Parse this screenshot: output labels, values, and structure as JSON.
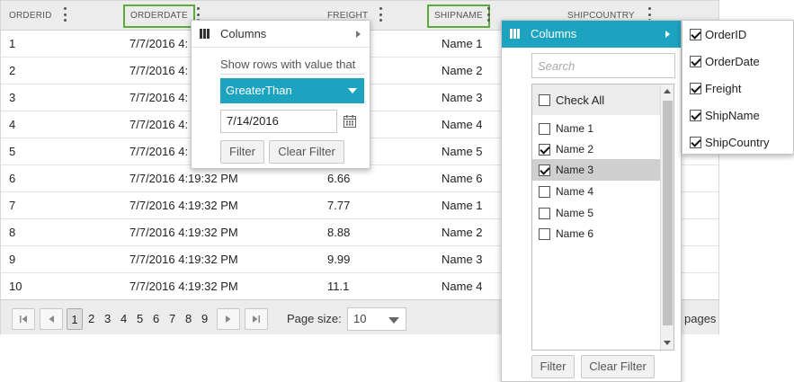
{
  "grid": {
    "columns": [
      {
        "id": "orderid",
        "label": "ORDERID"
      },
      {
        "id": "orderdate",
        "label": "ORDERDATE"
      },
      {
        "id": "freight",
        "label": "FREIGHT"
      },
      {
        "id": "shipname",
        "label": "SHIPNAME"
      },
      {
        "id": "shipcountry",
        "label": "SHIPCOUNTRY"
      }
    ],
    "rows": [
      {
        "orderid": "1",
        "orderdate": "7/7/2016 4:",
        "shipname": "Name 1"
      },
      {
        "orderid": "2",
        "orderdate": "7/7/2016 4:",
        "shipname": "Name 2"
      },
      {
        "orderid": "3",
        "orderdate": "7/7/2016 4:",
        "shipname": "Name 3"
      },
      {
        "orderid": "4",
        "orderdate": "7/7/2016 4:",
        "shipname": "Name 4"
      },
      {
        "orderid": "5",
        "orderdate": "7/7/2016 4:",
        "shipname": "Name 5"
      },
      {
        "orderid": "6",
        "orderdate": "7/7/2016 4:19:32 PM",
        "freight": "6.66",
        "shipname": "Name 6"
      },
      {
        "orderid": "7",
        "orderdate": "7/7/2016 4:19:32 PM",
        "freight": "7.77",
        "shipname": "Name 1"
      },
      {
        "orderid": "8",
        "orderdate": "7/7/2016 4:19:32 PM",
        "freight": "8.88",
        "shipname": "Name 2"
      },
      {
        "orderid": "9",
        "orderdate": "7/7/2016 4:19:32 PM",
        "freight": "9.99",
        "shipname": "Name 3"
      },
      {
        "orderid": "10",
        "orderdate": "7/7/2016 4:19:32 PM",
        "freight": "11.1",
        "shipname": "Name 4"
      }
    ]
  },
  "pager": {
    "pages": [
      "1",
      "2",
      "3",
      "4",
      "5",
      "6",
      "7",
      "8",
      "9"
    ],
    "current_page": "1",
    "page_size_label": "Page size:",
    "page_size_value": "10",
    "pages_suffix": "pages"
  },
  "filter_menu": {
    "columns_label": "Columns",
    "show_rows_label": "Show rows with value that",
    "condition": "GreaterThan",
    "value": "7/14/2016",
    "filter_button": "Filter",
    "clear_button": "Clear Filter"
  },
  "checklist_menu": {
    "columns_label": "Columns",
    "search_placeholder": "Search",
    "check_all_label": "Check All",
    "items": [
      {
        "label": "Name 1",
        "checked": false
      },
      {
        "label": "Name 2",
        "checked": true
      },
      {
        "label": "Name 3",
        "checked": true,
        "selected": true
      },
      {
        "label": "Name 4",
        "checked": false
      },
      {
        "label": "Name 5",
        "checked": false
      },
      {
        "label": "Name 6",
        "checked": false
      }
    ],
    "filter_button": "Filter",
    "clear_button": "Clear Filter"
  },
  "column_chooser": {
    "items": [
      {
        "label": "OrderID",
        "checked": true
      },
      {
        "label": "OrderDate",
        "checked": true
      },
      {
        "label": "Freight",
        "checked": true
      },
      {
        "label": "ShipName",
        "checked": true
      },
      {
        "label": "ShipCountry",
        "checked": true
      }
    ]
  },
  "colors": {
    "accent": "#1ca3c0",
    "highlight_border": "#5bab38"
  }
}
